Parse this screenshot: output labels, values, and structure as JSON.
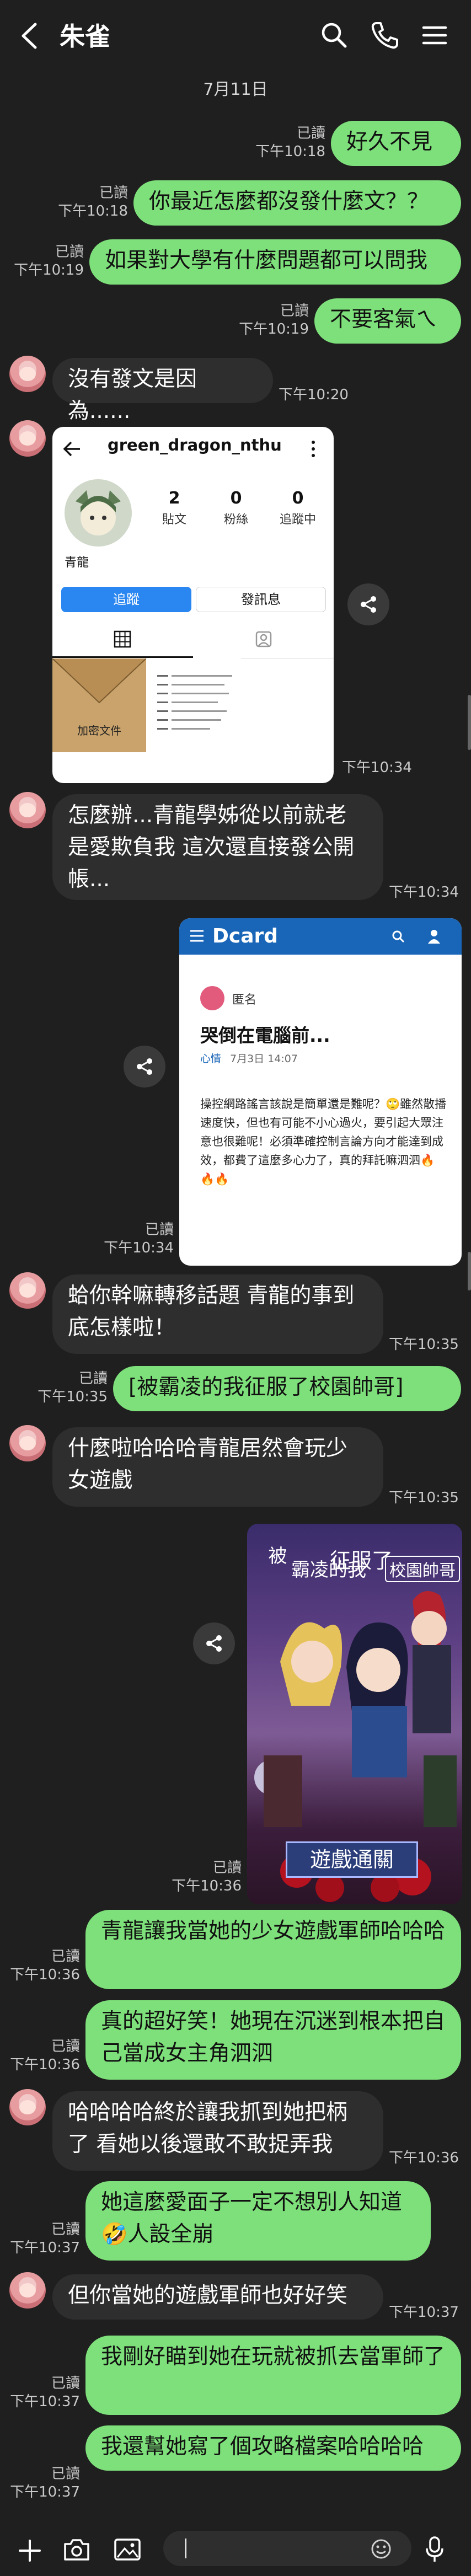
{
  "header": {
    "title": "朱雀"
  },
  "date_label": "7月11日",
  "messages": [
    {
      "id": "m1",
      "dir": "out",
      "text": "好久不見",
      "status": "已讀",
      "time": "下午10:18"
    },
    {
      "id": "m2",
      "dir": "out",
      "text": "你最近怎麼都沒發什麼文？？",
      "status": "已讀",
      "time": "下午10:18"
    },
    {
      "id": "m3",
      "dir": "out",
      "text": "如果對大學有什麼問題都可以問我",
      "status": "已讀",
      "time": "下午10:19"
    },
    {
      "id": "m4",
      "dir": "out",
      "text": "不要客氣ㄟ",
      "status": "已讀",
      "time": "下午10:19"
    },
    {
      "id": "m5",
      "dir": "in",
      "text": "沒有發文是因為......",
      "time": "下午10:20"
    },
    {
      "id": "m6",
      "dir": "in",
      "type": "image",
      "time": "下午10:34"
    },
    {
      "id": "m7",
      "dir": "in",
      "text": "怎麼辦...青龍學姊從以前就老是愛欺負我 這次還直接發公開帳...",
      "time": "下午10:34"
    },
    {
      "id": "m8",
      "dir": "out",
      "type": "image",
      "status": "已讀",
      "time": "下午10:34"
    },
    {
      "id": "m9",
      "dir": "in",
      "text": "蛤你幹嘛轉移話題 青龍的事到底怎樣啦！",
      "time": "下午10:35"
    },
    {
      "id": "m10",
      "dir": "out",
      "text": "[被霸凌的我征服了校園帥哥]",
      "status": "已讀",
      "time": "下午10:35"
    },
    {
      "id": "m11",
      "dir": "in",
      "text": "什麼啦哈哈哈青龍居然會玩少女遊戲",
      "time": "下午10:35"
    },
    {
      "id": "m12",
      "dir": "out",
      "type": "image",
      "status": "已讀",
      "time": "下午10:36"
    },
    {
      "id": "m13",
      "dir": "out",
      "text": "青龍讓我當她的少女遊戲軍師哈哈哈",
      "status": "已讀",
      "time": "下午10:36"
    },
    {
      "id": "m14",
      "dir": "out",
      "text": "真的超好笑！她現在沉迷到根本把自己當成女主角泗泗",
      "status": "已讀",
      "time": "下午10:36"
    },
    {
      "id": "m15",
      "dir": "in",
      "text": "哈哈哈哈終於讓我抓到她把柄了 看她以後還敢不敢捉弄我",
      "time": "下午10:36"
    },
    {
      "id": "m16",
      "dir": "out",
      "text": "她這麼愛面子一定不想別人知道🤣人設全崩",
      "status": "已讀",
      "time": "下午10:37"
    },
    {
      "id": "m17",
      "dir": "in",
      "text": "但你當她的遊戲軍師也好好笑",
      "time": "下午10:37"
    },
    {
      "id": "m18",
      "dir": "out",
      "text": "我剛好瞄到她在玩就被抓去當軍師了",
      "status": "已讀",
      "time": "下午10:37"
    },
    {
      "id": "m19",
      "dir": "out",
      "text": "我還幫她寫了個攻略檔案哈哈哈哈",
      "status": "已讀",
      "time": "下午10:37"
    }
  ],
  "ig_card": {
    "username": "green_dragon_nthu",
    "posts_count": "2",
    "posts_label": "貼文",
    "followers_count": "0",
    "followers_label": "粉絲",
    "following_count": "0",
    "following_label": "追蹤中",
    "display_name": "青龍",
    "follow_button": "追蹤",
    "message_button": "發訊息",
    "thumb_label": "加密文件"
  },
  "dcard_card": {
    "logo": "Dcard",
    "anon_label": "匿名",
    "post_title": "哭倒在電腦前...",
    "board": "心情",
    "post_date": "7月3日 14:07",
    "body": "操控網路謠言該說是簡單還是難呢？🙄雖然散播速度快，但也有可能不小心過火，要引起大眾注意也很難呢！必須準確控制言論方向才能達到成效，都費了這麼多心力了，真的拜託嘛泗泗🔥🔥🔥"
  },
  "game_card": {
    "title_part1": "被",
    "title_part2": "霸凌的我",
    "title_part3": "征服了",
    "title_part4": "校園帥哥",
    "clear_label": "遊戲通關"
  },
  "icons": {
    "back": "chevron-left-icon",
    "search": "search-icon",
    "call": "phone-icon",
    "menu": "hamburger-menu-icon",
    "share": "share-icon",
    "add": "plus-icon",
    "camera": "camera-icon",
    "gallery": "image-icon",
    "emoji": "emoji-icon",
    "mic": "microphone-icon"
  },
  "colors": {
    "background": "#1f1f1f",
    "outgoing_bubble": "#7ee07b",
    "incoming_bubble": "#2e2e2e",
    "meta_text": "#c9c9c9"
  }
}
